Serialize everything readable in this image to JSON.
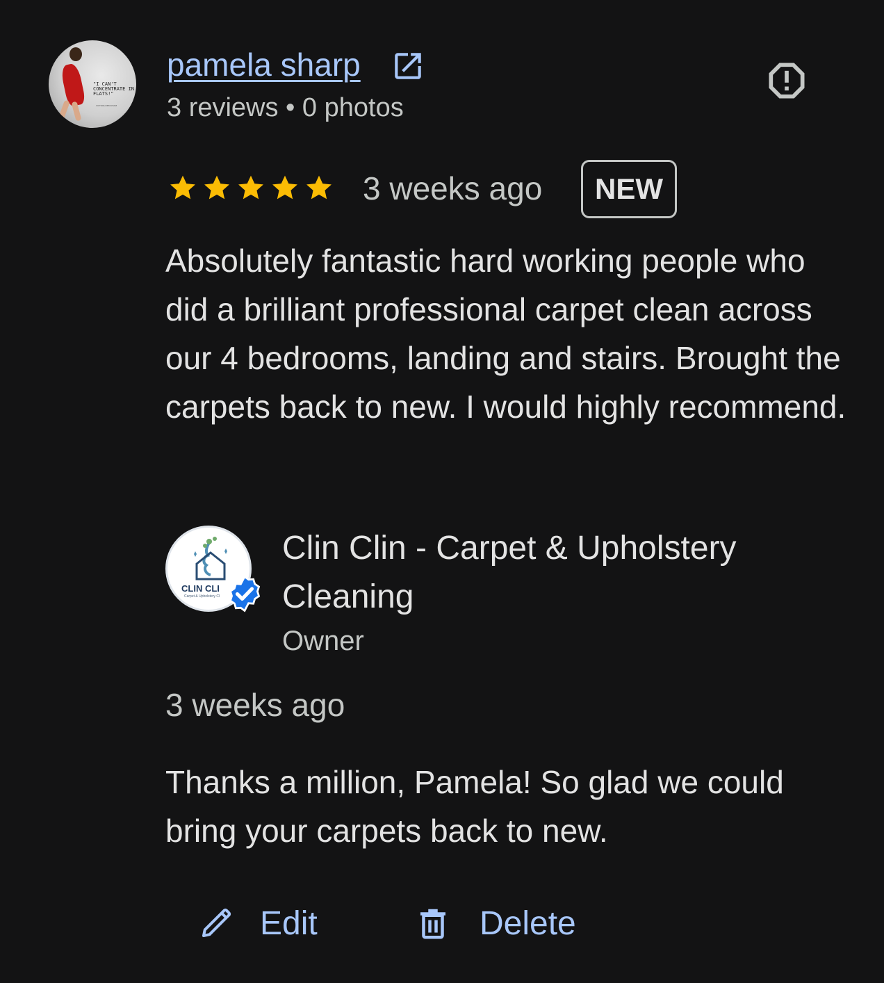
{
  "reviewer": {
    "name": "pamela sharp",
    "meta": "3 reviews • 0 photos",
    "avatar_quote": "\"I CAN'T CONCENTRATE IN FLATS!\"",
    "avatar_quote_sub": "VICTORIA BECKHAM"
  },
  "review": {
    "rating": 5,
    "rating_max": 5,
    "time": "3 weeks ago",
    "badge": "NEW",
    "text": "Absolutely fantastic hard working people who did a brilliant professional carpet clean across our 4 bedrooms, landing and stairs. Brought the carpets back to new. I would highly recommend."
  },
  "owner_reply": {
    "business_name": "Clin Clin - Carpet & Upholstery Cleaning",
    "role": "Owner",
    "logo_text": "CLIN CLI",
    "logo_sub": "Carpet & Upholstery Cl",
    "time": "3 weeks ago",
    "text": "Thanks a million, Pamela! So glad we could bring your carpets back to new."
  },
  "actions": {
    "edit_label": "Edit",
    "delete_label": "Delete"
  },
  "icons": {
    "external_link": "external-link-icon",
    "report": "report-icon",
    "star": "star-icon",
    "verified": "verified-badge-icon",
    "edit": "pencil-icon",
    "delete": "trash-icon"
  },
  "colors": {
    "background": "#131314",
    "link": "#a8c7fa",
    "star": "#fbbc04",
    "text_primary": "#e3e3e3",
    "text_secondary": "#c4c7c5",
    "verified": "#1a73e8"
  }
}
